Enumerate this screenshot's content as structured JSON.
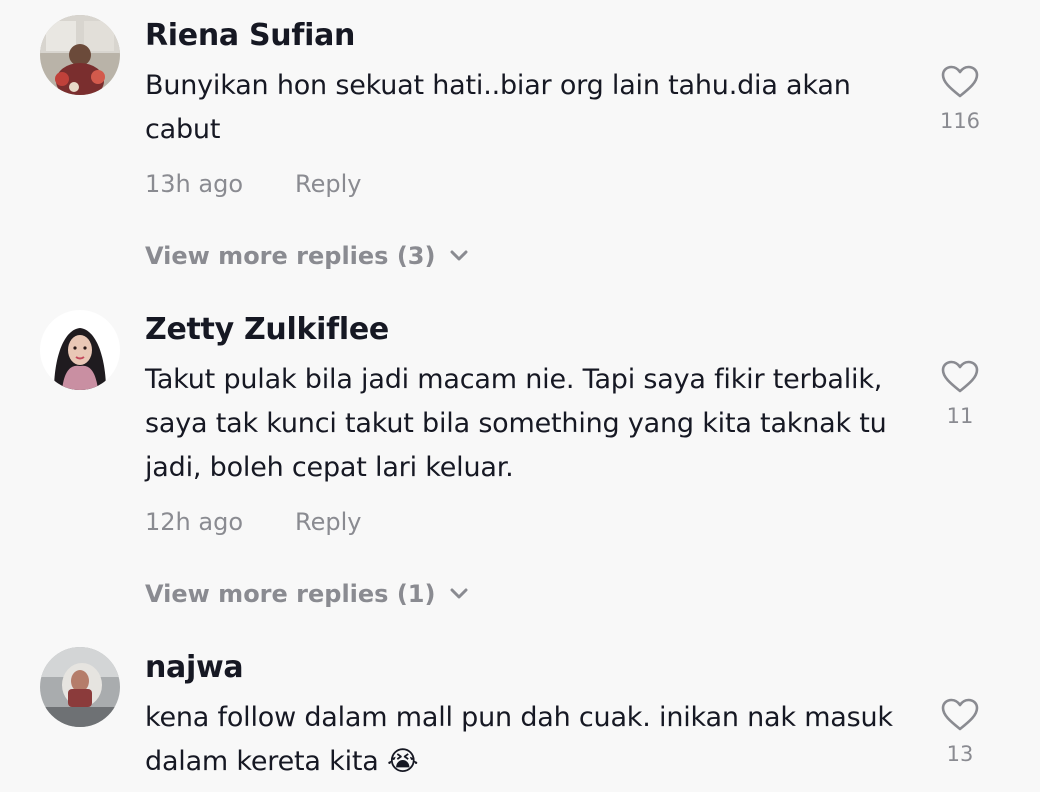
{
  "colors": {
    "background": "#f8f8f8",
    "text_primary": "#161823",
    "text_secondary": "#8a8b91"
  },
  "comments": [
    {
      "username": "Riena Sufian",
      "text": "Bunyikan hon sekuat hati..biar org lain tahu.dia akan cabut",
      "time": "13h ago",
      "reply_label": "Reply",
      "likes": "116",
      "view_more": "View more replies (3)",
      "like_icon": "heart-outline-icon",
      "avatar_icon": "avatar-photo"
    },
    {
      "username": "Zetty Zulkiflee",
      "text": "Takut pulak bila jadi macam nie. Tapi saya fikir terbalik, saya tak kunci takut bila something yang kita taknak tu jadi, boleh cepat lari keluar.",
      "time": "12h ago",
      "reply_label": "Reply",
      "likes": "11",
      "view_more": "View more replies (1)",
      "like_icon": "heart-outline-icon",
      "avatar_icon": "avatar-photo"
    },
    {
      "username": "najwa",
      "text": "kena follow dalam mall pun dah cuak. inikan nak masuk dalam kereta kita 😭",
      "likes": "13",
      "like_icon": "heart-outline-icon",
      "avatar_icon": "avatar-photo"
    }
  ]
}
